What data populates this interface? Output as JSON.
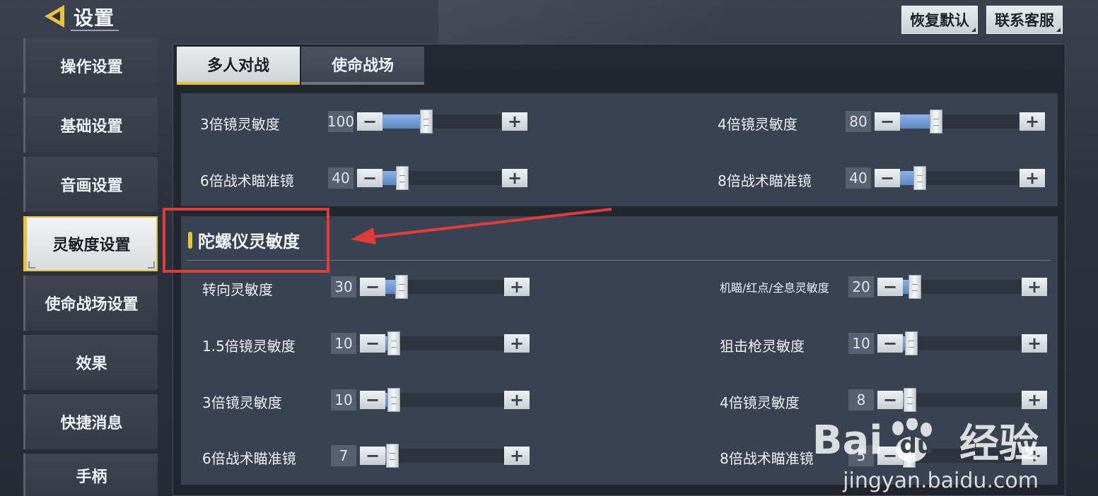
{
  "header": {
    "title": "设置",
    "buttons": [
      "恢复默认",
      "联系客服"
    ]
  },
  "sidebar": {
    "items": [
      {
        "label": "操作设置",
        "active": false
      },
      {
        "label": "基础设置",
        "active": false
      },
      {
        "label": "音画设置",
        "active": false
      },
      {
        "label": "灵敏度设置",
        "active": true
      },
      {
        "label": "使命战场设置",
        "active": false
      },
      {
        "label": "效果",
        "active": false
      },
      {
        "label": "快捷消息",
        "active": false
      },
      {
        "label": "手柄",
        "active": false
      }
    ]
  },
  "tabs": [
    {
      "label": "多人对战",
      "active": true
    },
    {
      "label": "使命战场",
      "active": false
    }
  ],
  "scope_section": {
    "rows": [
      {
        "left": {
          "label": "3倍镜灵敏度",
          "value": 100
        },
        "right": {
          "label": "4倍镜灵敏度",
          "value": 80
        }
      },
      {
        "left": {
          "label": "6倍战术瞄准镜",
          "value": 40
        },
        "right": {
          "label": "8倍战术瞄准镜",
          "value": 40
        }
      }
    ]
  },
  "gyro_section": {
    "title": "陀螺仪灵敏度",
    "rows": [
      {
        "left": {
          "label": "转向灵敏度",
          "value": 30
        },
        "right": {
          "label": "机瞄/红点/全息灵敏度",
          "value": 20
        }
      },
      {
        "left": {
          "label": "1.5倍镜灵敏度",
          "value": 10
        },
        "right": {
          "label": "狙击枪灵敏度",
          "value": 10
        }
      },
      {
        "left": {
          "label": "3倍镜灵敏度",
          "value": 10
        },
        "right": {
          "label": "4倍镜灵敏度",
          "value": 8
        }
      },
      {
        "left": {
          "label": "6倍战术瞄准镜",
          "value": 7
        },
        "right": {
          "label": "8倍战术瞄准镜",
          "value": 5
        }
      }
    ]
  },
  "slider_max": 300,
  "watermark": {
    "brand": "Bai",
    "brand_suffix": "du",
    "brand_cn": "经验",
    "url": "jingyan.baidu.com"
  },
  "colors": {
    "accent": "#e9c43a",
    "slider_fill": "#6f9ad3",
    "annotation": "#e23b3b"
  },
  "icons": {
    "back": "back-arrow-icon",
    "plus": "plus-icon",
    "minus": "minus-icon"
  }
}
